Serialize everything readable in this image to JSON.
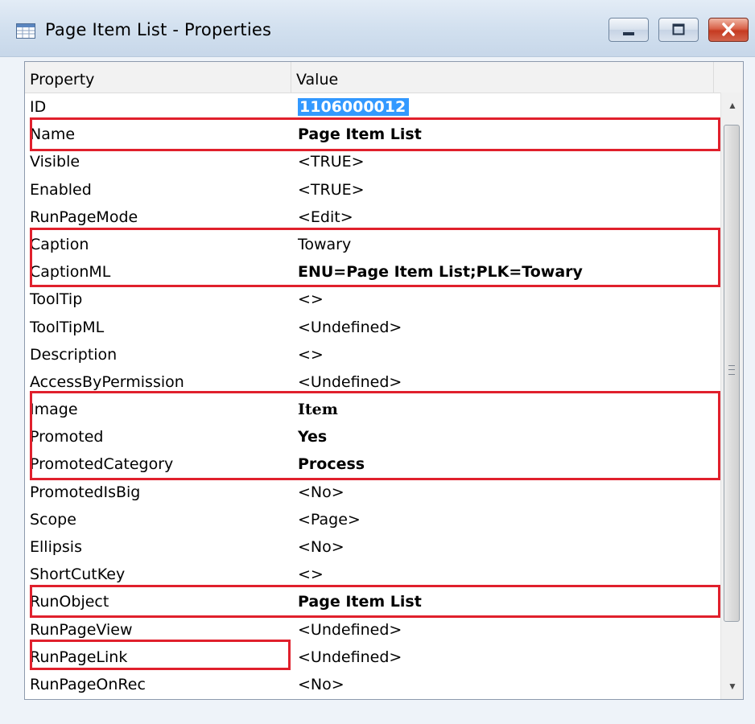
{
  "window": {
    "title": "Page Item List - Properties"
  },
  "table": {
    "headers": {
      "property": "Property",
      "value": "Value"
    },
    "rows": [
      {
        "property": "ID",
        "value": "1106000012"
      },
      {
        "property": "Name",
        "value": "Page Item List"
      },
      {
        "property": "Visible",
        "value": "<TRUE>"
      },
      {
        "property": "Enabled",
        "value": "<TRUE>"
      },
      {
        "property": "RunPageMode",
        "value": "<Edit>"
      },
      {
        "property": "Caption",
        "value": "Towary"
      },
      {
        "property": "CaptionML",
        "value": "ENU=Page Item List;PLK=Towary"
      },
      {
        "property": "ToolTip",
        "value": "<>"
      },
      {
        "property": "ToolTipML",
        "value": "<Undefined>"
      },
      {
        "property": "Description",
        "value": "<>"
      },
      {
        "property": "AccessByPermission",
        "value": "<Undefined>"
      },
      {
        "property": "Image",
        "value": "Item"
      },
      {
        "property": "Promoted",
        "value": "Yes"
      },
      {
        "property": "PromotedCategory",
        "value": "Process"
      },
      {
        "property": "PromotedIsBig",
        "value": "<No>"
      },
      {
        "property": "Scope",
        "value": "<Page>"
      },
      {
        "property": "Ellipsis",
        "value": "<No>"
      },
      {
        "property": "ShortCutKey",
        "value": "<>"
      },
      {
        "property": "RunObject",
        "value": "Page Item List"
      },
      {
        "property": "RunPageView",
        "value": "<Undefined>"
      },
      {
        "property": "RunPageLink",
        "value": "<Undefined>"
      },
      {
        "property": "RunPageOnRec",
        "value": "<No>"
      }
    ]
  },
  "colors": {
    "highlight_border": "#e0202c",
    "selection": "#3399ff"
  },
  "icons": {
    "window_icon": "table-icon",
    "minimize": "minimize-icon",
    "maximize": "maximize-icon",
    "close": "close-icon",
    "scroll_up": "up-arrow-icon",
    "scroll_down": "down-arrow-icon"
  }
}
